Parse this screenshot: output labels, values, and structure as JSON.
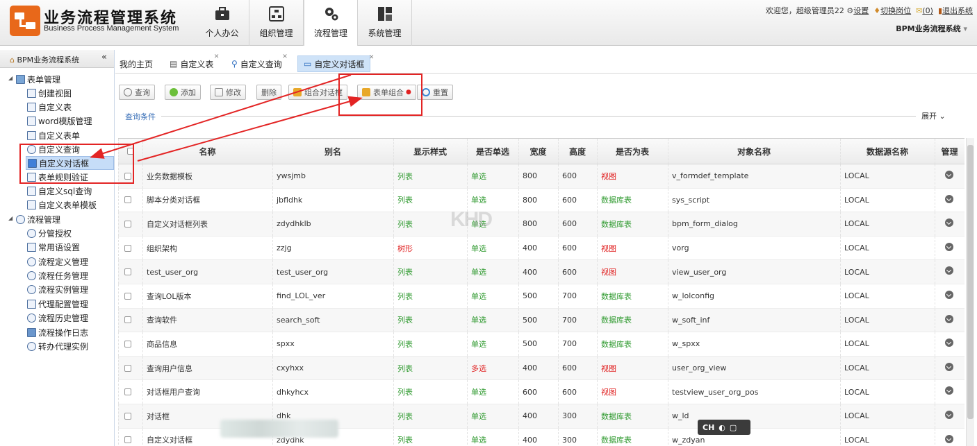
{
  "header": {
    "title": "业务流程管理系统",
    "subtitle": "Business Process Management System",
    "modules": [
      {
        "label": "个人办公",
        "icon": "briefcase-icon"
      },
      {
        "label": "组织管理",
        "icon": "org-chart-icon"
      },
      {
        "label": "流程管理",
        "icon": "gears-icon"
      },
      {
        "label": "系统管理",
        "icon": "dashboard-icon"
      }
    ],
    "active_module": "流程管理",
    "welcome": "欢迎您，超级管理员22",
    "settings": "设置",
    "switch_post": "切换岗位",
    "messages": "(0)",
    "logout": "退出系统",
    "system_name": "BPM业务流程系统"
  },
  "sidebar": {
    "header": "BPM业务流程系统",
    "collapse": "«",
    "groups": [
      {
        "label": "表单管理",
        "items": [
          "创建视图",
          "自定义表",
          "word模版管理",
          "自定义表单",
          "自定义查询",
          "自定义对话框",
          "表单规则验证",
          "自定义sql查询",
          "自定义表单模板"
        ]
      },
      {
        "label": "流程管理",
        "items": [
          "分管授权",
          "常用语设置",
          "流程定义管理",
          "流程任务管理",
          "流程实例管理",
          "代理配置管理",
          "流程历史管理",
          "流程操作日志",
          "转办代理实例"
        ]
      }
    ],
    "selected": "自定义对话框"
  },
  "tabs": [
    {
      "label": "我的主页"
    },
    {
      "label": "自定义表"
    },
    {
      "label": "自定义查询"
    },
    {
      "label": "自定义对话框"
    }
  ],
  "toolbar": {
    "query": "查询",
    "add": "添加",
    "edit": "修改",
    "delete": "删除",
    "combo_dialog": "组合对话框",
    "form_combo": "表单组合",
    "reset": "重置"
  },
  "query_condition": "查询条件",
  "expand": "展开",
  "grid": {
    "headers": [
      "名称",
      "别名",
      "显示样式",
      "是否单选",
      "宽度",
      "高度",
      "是否为表",
      "对象名称",
      "数据源名称",
      "管理"
    ],
    "rows": [
      [
        "业务数据模板",
        "ywsjmb",
        "列表",
        "单选",
        "800",
        "600",
        "视图",
        "v_formdef_template",
        "LOCAL"
      ],
      [
        "脚本分类对话框",
        "jbfldhk",
        "列表",
        "单选",
        "800",
        "600",
        "数据库表",
        "sys_script",
        "LOCAL"
      ],
      [
        "自定义对话框列表",
        "zdydhklb",
        "列表",
        "单选",
        "800",
        "600",
        "数据库表",
        "bpm_form_dialog",
        "LOCAL"
      ],
      [
        "组织架构",
        "zzjg",
        "树形",
        "单选",
        "400",
        "600",
        "视图",
        "vorg",
        "LOCAL"
      ],
      [
        "test_user_org",
        "test_user_org",
        "列表",
        "单选",
        "400",
        "600",
        "视图",
        "view_user_org",
        "LOCAL"
      ],
      [
        "查询LOL版本",
        "find_LOL_ver",
        "列表",
        "单选",
        "500",
        "700",
        "数据库表",
        "w_lolconfig",
        "LOCAL"
      ],
      [
        "查询软件",
        "search_soft",
        "列表",
        "单选",
        "500",
        "700",
        "数据库表",
        "w_soft_inf",
        "LOCAL"
      ],
      [
        "商品信息",
        "spxx",
        "列表",
        "单选",
        "500",
        "700",
        "数据库表",
        "w_spxx",
        "LOCAL"
      ],
      [
        "查询用户信息",
        "cxyhxx",
        "列表",
        "多选",
        "400",
        "600",
        "视图",
        "user_org_view",
        "LOCAL"
      ],
      [
        "对话框用户查询",
        "dhkyhcx",
        "列表",
        "单选",
        "600",
        "600",
        "视图",
        "testview_user_org_pos",
        "LOCAL"
      ],
      [
        "对话框",
        "dhk",
        "列表",
        "单选",
        "400",
        "300",
        "数据库表",
        "w_ld",
        "LOCAL"
      ],
      [
        "自定义对话框",
        "zdydhk",
        "列表",
        "单选",
        "400",
        "300",
        "数据库表",
        "w_zdyan",
        "LOCAL"
      ]
    ]
  },
  "watermark": "KHD",
  "ime": "CH",
  "colors": {
    "accent_orange": "#e8681a",
    "list_green": "#2f9a2f",
    "tree_red": "#e02020",
    "view_red": "#e02020",
    "highlight_red": "#e32424",
    "selected_blue": "#c6ddf8"
  }
}
